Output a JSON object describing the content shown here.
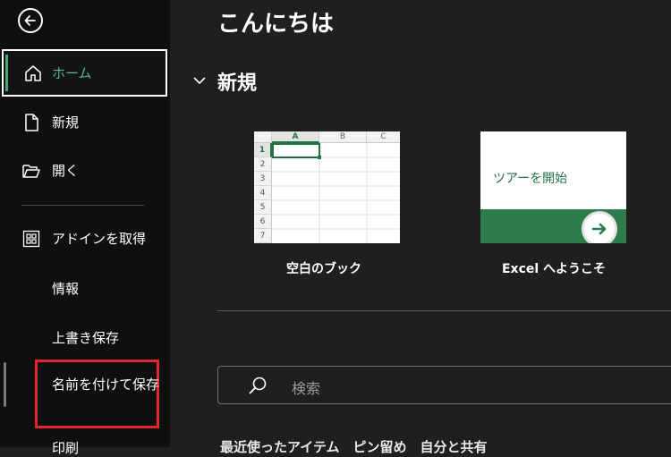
{
  "sidebar": {
    "back_icon": "arrow-left-icon",
    "items": [
      {
        "label": "ホーム",
        "icon": "home-icon"
      },
      {
        "label": "新規",
        "icon": "new-file-icon"
      },
      {
        "label": "開く",
        "icon": "folder-open-icon"
      },
      {
        "label": "アドインを取得",
        "icon": "grid-icon"
      }
    ],
    "sub_items": [
      "情報",
      "上書き保存",
      "名前を付けて保存",
      "印刷"
    ]
  },
  "main": {
    "greeting": "こんにちは",
    "new_section": {
      "heading": "新規",
      "templates": [
        {
          "title": "空白のブック",
          "thumbnail": "blank-workbook"
        },
        {
          "title": "Excel へようこそ",
          "thumbnail_text": "ツアーを開始"
        }
      ],
      "sheet_preview": {
        "columns": [
          "A",
          "B",
          "C"
        ],
        "rows": [
          "1",
          "2",
          "3",
          "4",
          "5",
          "6",
          "7"
        ]
      }
    },
    "search": {
      "placeholder": "検索"
    },
    "bottom_tabs": "最近使ったアイテム　ピン留め　自分と共有"
  },
  "colors": {
    "accent_green": "#57b986",
    "excel_green": "#2e7b4c",
    "highlight_red": "#e3262c",
    "sidebar_bg": "#0f0f0f",
    "main_bg": "#1f1f1f"
  }
}
